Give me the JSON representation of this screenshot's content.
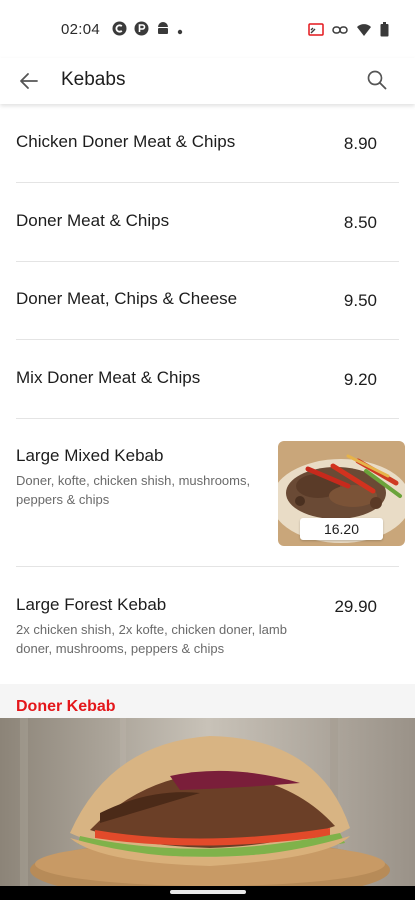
{
  "status_bar": {
    "time": "02:04",
    "left_icons": [
      "circle-c-icon",
      "circle-p-icon",
      "android-icon",
      "dot-icon"
    ],
    "right_icons": [
      "cast-icon",
      "link-icon",
      "wifi-icon",
      "battery-icon"
    ]
  },
  "header": {
    "title": "Kebabs",
    "back_icon": "arrow-left-icon",
    "search_icon": "search-icon"
  },
  "menu": {
    "items": [
      {
        "name": "Chicken Doner Meat & Chips",
        "price": "8.90",
        "description": ""
      },
      {
        "name": "Doner Meat & Chips",
        "price": "8.50",
        "description": ""
      },
      {
        "name": "Doner Meat, Chips & Cheese",
        "price": "9.50",
        "description": ""
      },
      {
        "name": "Mix Doner Meat & Chips",
        "price": "9.20",
        "description": ""
      },
      {
        "name": "Large Mixed Kebab",
        "price": "16.20",
        "description_line1": "Doner, kofte, chicken shish, mushrooms,",
        "description_line2": "peppers & chips"
      },
      {
        "name": "Large Forest Kebab",
        "price": "29.90",
        "description_line1": "2x chicken shish, 2x kofte, chicken doner, lamb",
        "description_line2": "doner, mushrooms, peppers & chips"
      }
    ]
  },
  "section": {
    "title": "Doner Kebab"
  },
  "colors": {
    "accent": "#e4171b",
    "divider": "#e4e4e4",
    "description": "#6a6a6a"
  }
}
